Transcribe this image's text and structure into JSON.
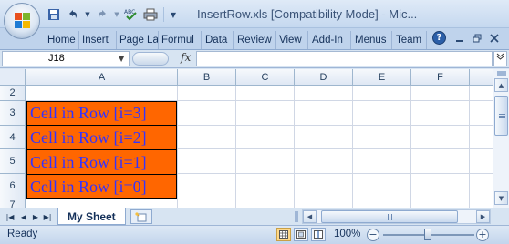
{
  "window": {
    "title": "InsertRow.xls  [Compatibility Mode] - Mic..."
  },
  "quick_access": {
    "icons": [
      "save-icon",
      "undo-icon",
      "redo-icon",
      "spelling-icon",
      "print-icon",
      "customize-icon"
    ]
  },
  "ribbon": {
    "tabs": [
      {
        "label": "Home"
      },
      {
        "label": "Insert"
      },
      {
        "label": "Page La"
      },
      {
        "label": "Formul"
      },
      {
        "label": "Data"
      },
      {
        "label": "Review"
      },
      {
        "label": "View"
      },
      {
        "label": "Add-In"
      },
      {
        "label": "Menus"
      },
      {
        "label": "Team"
      }
    ],
    "help_label": "?"
  },
  "formula_bar": {
    "name_box": "J18",
    "fx_label": "fx",
    "formula": ""
  },
  "grid": {
    "columns": [
      "A",
      "B",
      "C",
      "D",
      "E",
      "F"
    ],
    "rows": [
      "2",
      "3",
      "4",
      "5",
      "6",
      "7"
    ],
    "cells": {
      "A3": "Cell in Row [i=3]",
      "A4": "Cell in Row [i=2]",
      "A5": "Cell in Row [i=1]",
      "A6": "Cell in Row [i=0]"
    },
    "cell_fill_color": "#ff6600",
    "cell_text_color": "#3333ff"
  },
  "sheets": {
    "active": "My Sheet"
  },
  "status": {
    "text": "Ready",
    "zoom": "100%",
    "zoom_minus": "−",
    "zoom_plus": "+"
  }
}
